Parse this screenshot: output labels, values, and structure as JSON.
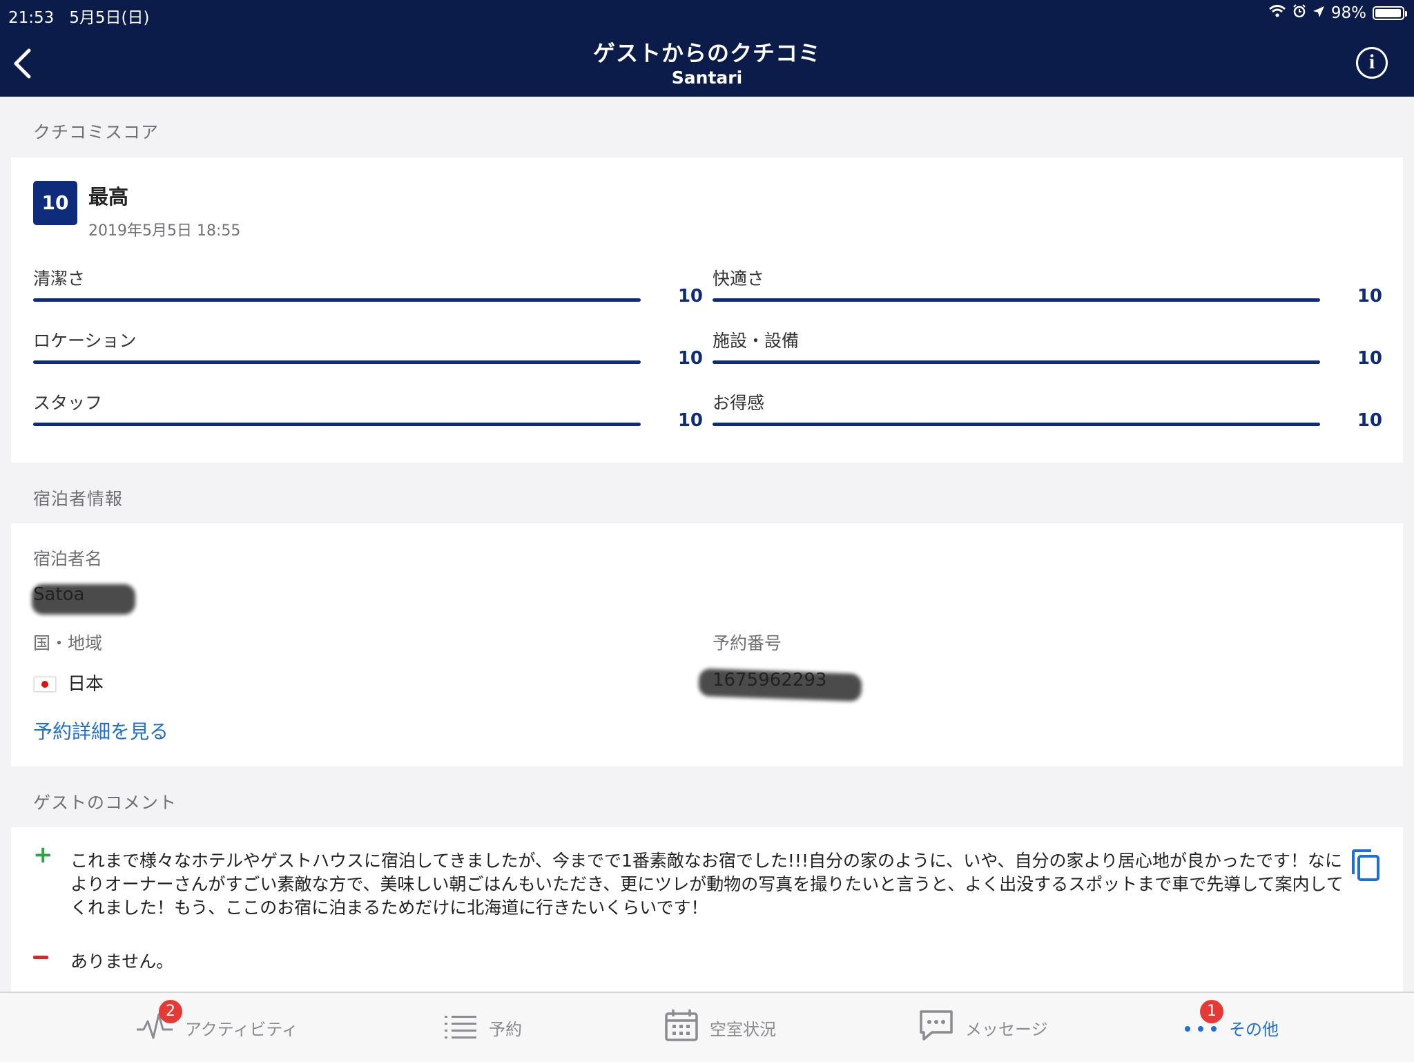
{
  "status_bar": {
    "time": "21:53",
    "date": "5月5日(日)",
    "battery": "98%",
    "battery_level": 0.98
  },
  "nav": {
    "title": "ゲストからのクチコミ",
    "subtitle": "Santari"
  },
  "score_section": {
    "label": "クチコミスコア",
    "overall_score": "10",
    "overall_label": "最高",
    "date": "2019年5月5日 18:55",
    "metrics": [
      {
        "name": "清潔さ",
        "value": "10",
        "fraction": 1.0
      },
      {
        "name": "快適さ",
        "value": "10",
        "fraction": 1.0
      },
      {
        "name": "ロケーション",
        "value": "10",
        "fraction": 1.0
      },
      {
        "name": "施設・設備",
        "value": "10",
        "fraction": 1.0
      },
      {
        "name": "スタッフ",
        "value": "10",
        "fraction": 1.0
      },
      {
        "name": "お得感",
        "value": "10",
        "fraction": 1.0
      }
    ]
  },
  "guest_section": {
    "label": "宿泊者情報",
    "guest_name_label": "宿泊者名",
    "guest_name": "Satoa",
    "country_label": "国・地域",
    "country": "日本",
    "booking_number_label": "予約番号",
    "booking_number": "1675962293",
    "details_link": "予約詳細を見る"
  },
  "comment_section": {
    "label": "ゲストのコメント",
    "positive": "これまで様々なホテルやゲストハウスに宿泊してきましたが、今までで1番素敵なお宿でした!!!自分の家のように、いや、自分の家より居心地が良かったです！なによりオーナーさんがすごい素敵な方で、美味しい朝ごはんもいただき、更にツレが動物の写真を撮りたいと言うと、よく出没するスポットまで車で先導して案内してくれました！もう、ここのお宿に泊まるためだけに北海道に行きたいくらいです！",
    "negative": "ありません。"
  },
  "tabbar": {
    "tabs": [
      {
        "label": "アクティビティ",
        "badge": "2"
      },
      {
        "label": "予約"
      },
      {
        "label": "空室状況"
      },
      {
        "label": "メッセージ"
      },
      {
        "label": "その他",
        "badge": "1"
      }
    ]
  },
  "colors": {
    "navy": "#0b1c4a",
    "score_blue": "#0e2b7c",
    "link_blue": "#1f6fd1",
    "badge_red": "#e53935",
    "positive_green": "#2aa845",
    "negative_red": "#d9262a"
  }
}
